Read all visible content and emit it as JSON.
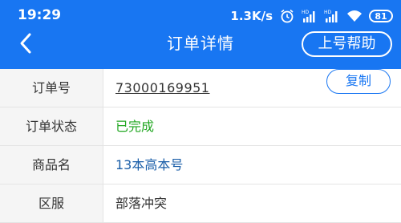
{
  "status_bar": {
    "time": "19:29",
    "net_speed": "1.3K/s",
    "battery": "81",
    "icons": [
      "alarm-icon",
      "hd-signal-icon",
      "hd-signal-icon",
      "wifi-icon",
      "battery-icon"
    ]
  },
  "header": {
    "title": "订单详情",
    "help_label": "上号帮助",
    "back_icon": "back-arrow-icon"
  },
  "details": {
    "rows": [
      {
        "label": "订单号",
        "value": "73000169951",
        "action": "复制"
      },
      {
        "label": "订单状态",
        "value": "已完成"
      },
      {
        "label": "商品名",
        "value": "13本高本号"
      },
      {
        "label": "区服",
        "value": "部落冲突"
      }
    ]
  },
  "colors": {
    "accent": "#1876f2",
    "status_done": "#22a722",
    "product_link": "#1a5ea8"
  }
}
